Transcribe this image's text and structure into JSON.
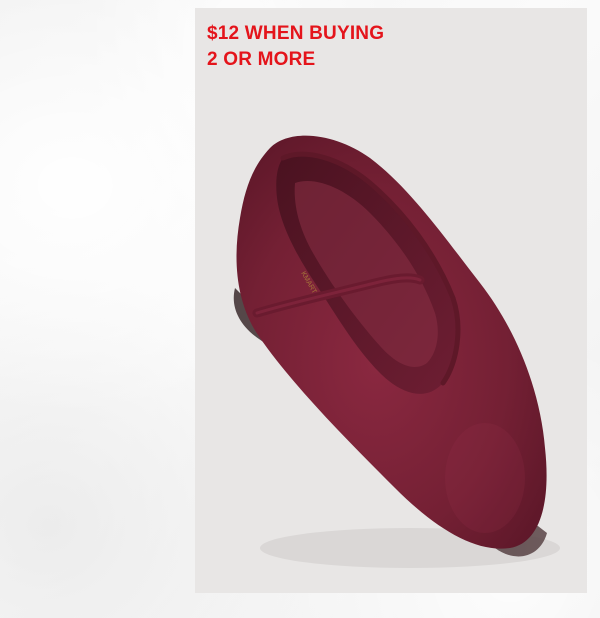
{
  "promo": {
    "line1": "$12 WHEN BUYING",
    "line2": "2 OR MORE",
    "color": "#e4141b"
  },
  "product": {
    "icon": "ballet-flat-shoe-image",
    "color": "#7a2037"
  }
}
